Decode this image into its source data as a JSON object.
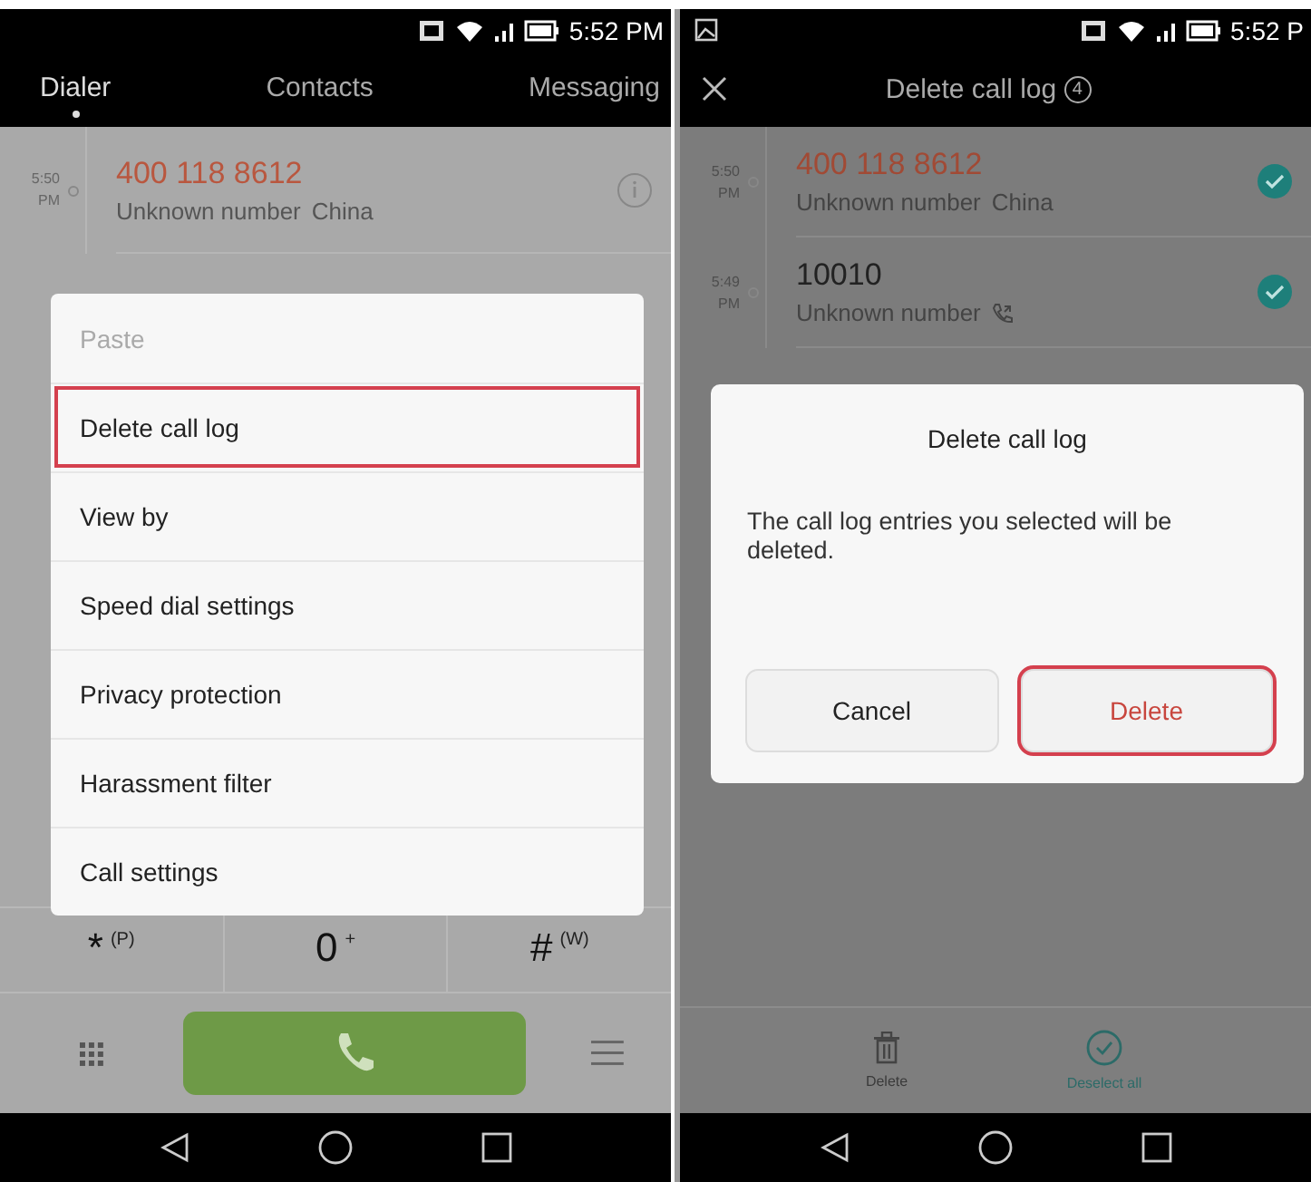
{
  "left_screen": {
    "status_bar": {
      "time": "5:52 PM"
    },
    "tabs": [
      {
        "label": "Dialer",
        "selected": true
      },
      {
        "label": "Contacts",
        "selected": false
      },
      {
        "label": "Messaging",
        "selected": false
      }
    ],
    "call_log": [
      {
        "time": "5:50",
        "period": "PM",
        "number": "400 118 8612",
        "missed": true,
        "label": "Unknown number",
        "location": "China"
      }
    ],
    "keypad_row": [
      {
        "digit": "*",
        "letters": "(P)"
      },
      {
        "digit": "0",
        "letters": "+"
      },
      {
        "digit": "#",
        "letters": "(W)"
      }
    ],
    "menu": [
      {
        "label": "Paste",
        "disabled": true,
        "highlighted": false
      },
      {
        "label": "Delete call log",
        "disabled": false,
        "highlighted": true
      },
      {
        "label": "View by",
        "disabled": false,
        "highlighted": false
      },
      {
        "label": "Speed dial settings",
        "disabled": false,
        "highlighted": false
      },
      {
        "label": "Privacy protection",
        "disabled": false,
        "highlighted": false
      },
      {
        "label": "Harassment filter",
        "disabled": false,
        "highlighted": false
      },
      {
        "label": "Call settings",
        "disabled": false,
        "highlighted": false
      }
    ]
  },
  "right_screen": {
    "status_bar": {
      "time": "5:52 P"
    },
    "header": {
      "title": "Delete call log",
      "count": "4"
    },
    "call_log": [
      {
        "time": "5:50",
        "period": "PM",
        "number": "400 118 8612",
        "missed": true,
        "label": "Unknown number",
        "location": "China",
        "checked": true
      },
      {
        "time": "5:49",
        "period": "PM",
        "number": "10010",
        "missed": false,
        "label": "Unknown number",
        "call_icon": true,
        "checked": true
      }
    ],
    "dialog": {
      "title": "Delete call log",
      "message": "The call log entries you selected will be deleted.",
      "buttons": [
        {
          "label": "Cancel",
          "kind": "neutral",
          "highlighted": false
        },
        {
          "label": "Delete",
          "kind": "destructive",
          "highlighted": true
        }
      ]
    },
    "toolbar": [
      {
        "label": "Delete",
        "kind": "trash"
      },
      {
        "label": "Deselect all",
        "kind": "deselect"
      }
    ]
  }
}
